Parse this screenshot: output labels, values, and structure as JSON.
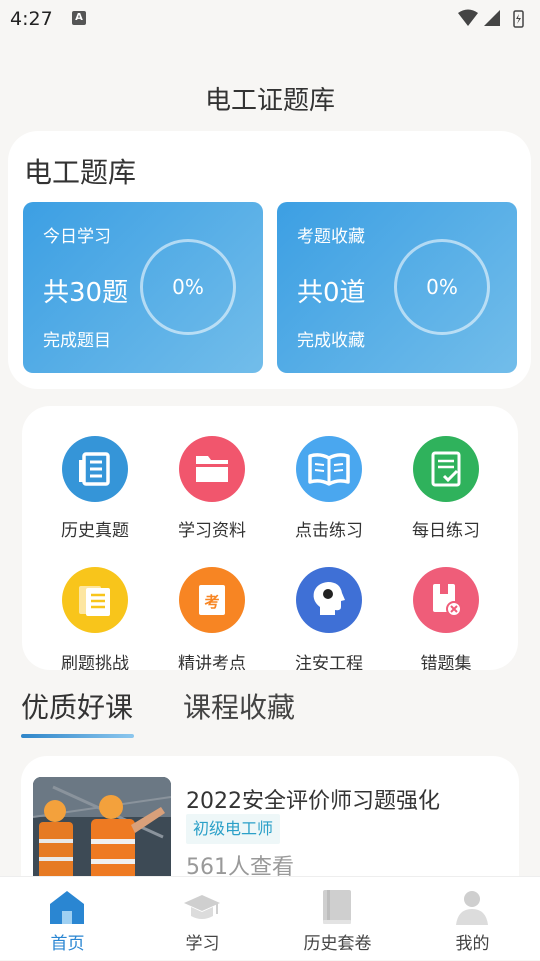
{
  "status_bar": {
    "time": "4:27",
    "badge": "A"
  },
  "page_title": "电工证题库",
  "question_bank": {
    "title": "电工题库",
    "cards": [
      {
        "label": "今日学习",
        "count": "共30题",
        "sub": "完成题目",
        "percent": "0%"
      },
      {
        "label": "考题收藏",
        "count": "共0道",
        "sub": "完成收藏",
        "percent": "0%"
      }
    ]
  },
  "grid": {
    "items": [
      {
        "label": "历史真题",
        "icon": "document-list-icon",
        "color": "#3595d8"
      },
      {
        "label": "学习资料",
        "icon": "folder-icon",
        "color": "#f1566d"
      },
      {
        "label": "点击练习",
        "icon": "open-book-icon",
        "color": "#4aa7ef"
      },
      {
        "label": "每日练习",
        "icon": "checklist-icon",
        "color": "#2fb25c"
      },
      {
        "label": "刷题挑战",
        "icon": "stacked-papers-icon",
        "color": "#f8c51b"
      },
      {
        "label": "精讲考点",
        "icon": "exam-paper-icon",
        "color": "#f78523"
      },
      {
        "label": "注安工程",
        "icon": "head-profile-icon",
        "color": "#3f70d6"
      },
      {
        "label": "错题集",
        "icon": "error-box-icon",
        "color": "#ef5d79"
      }
    ],
    "exam_glyph": "考"
  },
  "tabs": {
    "active": "优质好课",
    "inactive": "课程收藏"
  },
  "course": {
    "title": "2022安全评价师习题强化",
    "tag": "初级电工师",
    "views": "561人查看"
  },
  "bottom_nav": [
    {
      "label": "首页",
      "icon": "home-icon",
      "active": true
    },
    {
      "label": "学习",
      "icon": "graduation-cap-icon",
      "active": false
    },
    {
      "label": "历史套卷",
      "icon": "book-icon",
      "active": false
    },
    {
      "label": "我的",
      "icon": "user-icon",
      "active": false
    }
  ],
  "colors": {
    "accent": "#2a86d2",
    "card_gradient_start": "#3c9fe3",
    "card_gradient_end": "#72bdea"
  }
}
